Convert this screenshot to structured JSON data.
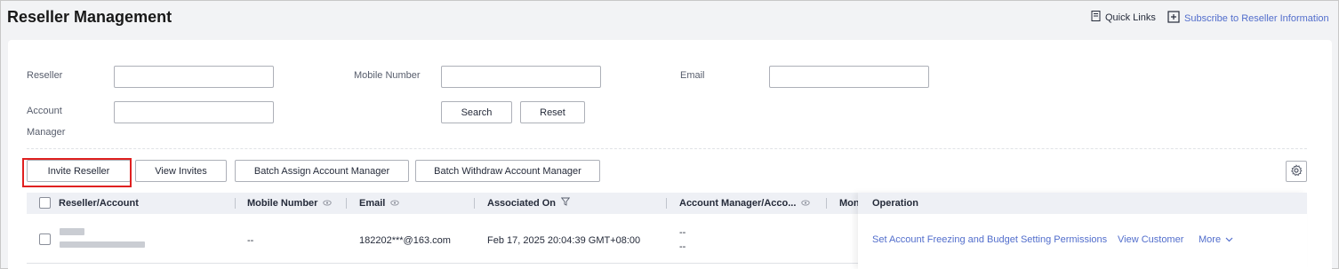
{
  "header": {
    "title": "Reseller Management",
    "quick_links": "Quick Links",
    "subscribe": "Subscribe to Reseller Information"
  },
  "filters": {
    "reseller_label": "Reseller",
    "mobile_label": "Mobile Number",
    "email_label": "Email",
    "account_manager_label_1": "Account",
    "account_manager_label_2": "Manager",
    "reseller_value": "",
    "mobile_value": "",
    "email_value": "",
    "account_manager_value": "",
    "search_button": "Search",
    "reset_button": "Reset"
  },
  "toolbar": {
    "invite": "Invite Reseller",
    "view_invites": "View Invites",
    "batch_assign": "Batch Assign Account Manager",
    "batch_withdraw": "Batch Withdraw Account Manager"
  },
  "table": {
    "columns": {
      "reseller": "Reseller/Account",
      "mobile": "Mobile Number",
      "email": "Email",
      "associated_on": "Associated On",
      "account_manager": "Account Manager/Acco...",
      "mon": "Mon",
      "operation": "Operation"
    },
    "rows": [
      {
        "mobile": "--",
        "email": "182202***@163.com",
        "associated_on": "Feb 17, 2025 20:04:39 GMT+08:00",
        "account_manager_1": "--",
        "account_manager_2": "--",
        "op_freeze": "Set Account Freezing and Budget Setting Permissions",
        "op_view": "View Customer",
        "op_more": "More"
      }
    ]
  },
  "colors": {
    "link": "#526ecc",
    "highlight": "#e02020",
    "header_bg": "#eef0f5"
  },
  "icons": [
    "document-icon",
    "subscribe-icon",
    "gear-icon",
    "eye-icon",
    "filter-icon",
    "chevron-down-icon"
  ]
}
